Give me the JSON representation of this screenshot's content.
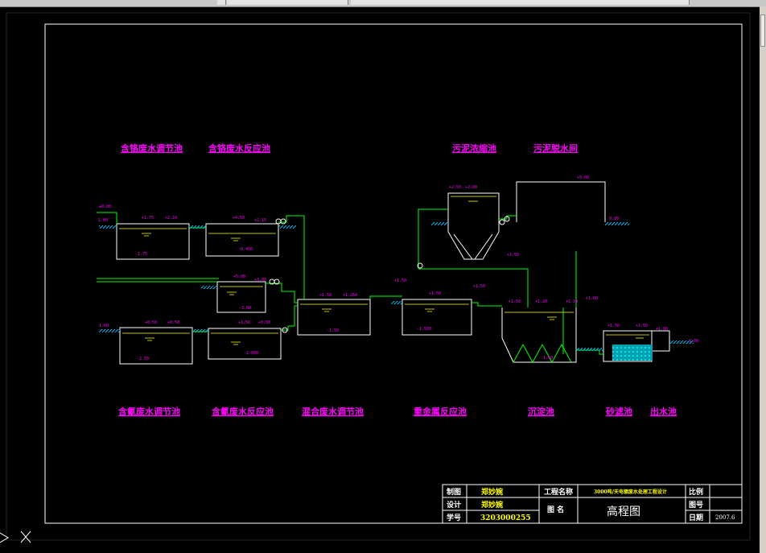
{
  "tanks": {
    "t1": "含铬废水调节池",
    "t2": "含铬废水反应池",
    "t3": "含氰废水调节池",
    "t4": "含氰废水反应池",
    "t5": "混合废水调节池",
    "t6": "重金属反应池",
    "t7": "沉淀池",
    "t8": "砂滤池",
    "t9": "出水池",
    "t10": "污泥浓缩池",
    "t11": "污泥脱水间"
  },
  "title_block": {
    "draw_label": "制图",
    "draw_name": "郑妙婉",
    "design_label": "设计",
    "design_name": "郑妙婉",
    "student_label": "学号",
    "student_id": "3203000255",
    "project_label": "工程名称",
    "project_name": "3000吨/天电镀废水处理工程设计",
    "figure_label": "图 名",
    "figure_name": "高程图",
    "scale_label": "比例",
    "sheet_label": "图号",
    "date_label": "日期",
    "date_value": "2007.6"
  },
  "colors": {
    "wall": "#ffffff",
    "pipe": "#00ff00",
    "label": "#ff00ff",
    "ground": "#00c0ff",
    "title": "#ffff00"
  }
}
